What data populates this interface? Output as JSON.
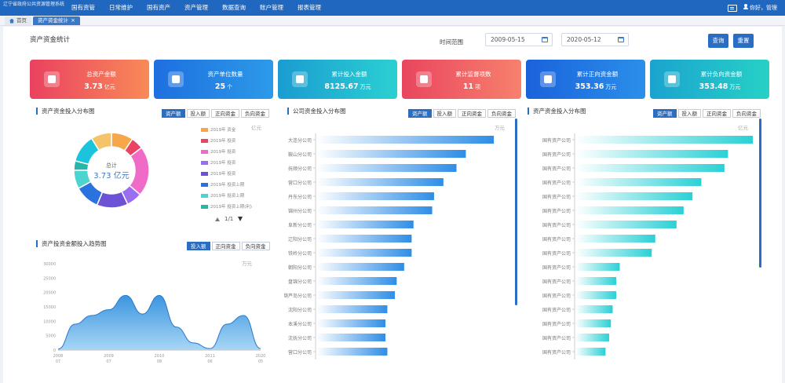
{
  "app": {
    "title": "辽宁省政府公共资源管理系统"
  },
  "nav": [
    "国有资管",
    "日常维护",
    "国有资产",
    "资产管理",
    "数据查询",
    "账户管理",
    "报表管理"
  ],
  "top_right": {
    "user": "你好，管理"
  },
  "tabs": [
    {
      "label": "首页"
    },
    {
      "label": "资产资金统计"
    }
  ],
  "filters": {
    "page_title": "资产资金统计",
    "time_label": "时间范围",
    "date_from": "2009-05-15",
    "date_to": "2020-05-12",
    "query_label": "查询",
    "reset_label": "重置"
  },
  "colors": {
    "accent": "#2a6ec4"
  },
  "cards": [
    {
      "title": "总资产金额",
      "value": "3.73",
      "unit": "亿元",
      "icon": "money-icon",
      "gradient": [
        "#ea4161",
        "#f98a57"
      ]
    },
    {
      "title": "资产单位数量",
      "value": "25",
      "unit": "个",
      "icon": "building-icon",
      "gradient": [
        "#1e6fe0",
        "#2c9ae8"
      ]
    },
    {
      "title": "累计投入金额",
      "value": "8125.67",
      "unit": "万元",
      "icon": "money-bag-icon",
      "gradient": [
        "#1a9cd1",
        "#2bd0d2"
      ]
    },
    {
      "title": "累计监督项数",
      "value": "11",
      "unit": "项",
      "icon": "puzzle-icon",
      "gradient": [
        "#e9455e",
        "#f7816d"
      ]
    },
    {
      "title": "累计正向资金额",
      "value": "353.36",
      "unit": "万元",
      "icon": "arrow-up-icon",
      "gradient": [
        "#1a62dc",
        "#2b8fea"
      ]
    },
    {
      "title": "累计负向资金额",
      "value": "353.48",
      "unit": "万元",
      "icon": "arrow-down-icon",
      "gradient": [
        "#1aa3cf",
        "#27d1c6"
      ]
    }
  ],
  "panel_donut": {
    "title": "资产资金投入分布图",
    "tabs": [
      "资产额",
      "投入额",
      "正向资金",
      "负向资金"
    ],
    "unit": "亿元",
    "center_label": "总计",
    "center_value": "3.73 亿元",
    "page_text": "1/1"
  },
  "panel_company": {
    "title": "公司资金投入分布图",
    "tabs": [
      "资产额",
      "投入额",
      "正向资金",
      "负向资金"
    ],
    "unit": "万元"
  },
  "panel_right": {
    "title": "资产资金投入分布图",
    "tabs": [
      "资产额",
      "投入额",
      "正向资金",
      "负向资金"
    ],
    "unit": "亿元"
  },
  "panel_trend": {
    "title": "资产投资金额投入趋势图",
    "tabs": [
      "投入额",
      "正向资金",
      "负向资金"
    ],
    "unit": "万元"
  },
  "chart_data": [
    {
      "type": "pie",
      "title": "资产资金投入分布图",
      "categories": [
        "2019年 资金",
        "2019年 投资",
        "2019年 投资",
        "2019年 投资",
        "2019年 投资",
        "2019年 投资上期",
        "2019年 投资上期",
        "2019年 投资上期(利)",
        "2019年 投资",
        "2019年 投资"
      ],
      "values": [
        0.35,
        0.2,
        0.8,
        0.25,
        0.5,
        0.4,
        0.3,
        0.15,
        0.45,
        0.33
      ],
      "colors": [
        "#f6a64b",
        "#ea4463",
        "#f06bc8",
        "#9a6ef0",
        "#6d52d6",
        "#2a72e0",
        "#4dd4d0",
        "#29b6a8",
        "#1cc3dc",
        "#f4c36a"
      ]
    },
    {
      "type": "bar",
      "orientation": "horizontal",
      "title": "公司资金投入分布图",
      "categories": [
        "大连分公司",
        "鞍山分公司",
        "抚顺分公司",
        "营口分公司",
        "丹东分公司",
        "锦州分公司",
        "阜新分公司",
        "辽阳分公司",
        "铁岭分公司",
        "朝阳分公司",
        "盘锦分公司",
        "葫芦岛分公司",
        "沈阳分公司",
        "本溪分公司",
        "沈抚分公司",
        "营口分公司"
      ],
      "values": [
        95,
        80,
        75,
        68,
        63,
        62,
        52,
        51,
        51,
        47,
        43,
        42,
        38,
        37,
        37,
        38
      ],
      "xlim": [
        0,
        100
      ]
    },
    {
      "type": "bar",
      "orientation": "horizontal",
      "title": "资产资金投入分布图",
      "categories": [
        "国有资产公司",
        "国有资产公司",
        "国有资产公司",
        "国有资产公司",
        "国有资产公司",
        "国有资产公司",
        "国有资产公司",
        "国有资产公司",
        "国有资产公司",
        "国有资产公司",
        "国有资产公司",
        "国有资产公司",
        "国有资产公司",
        "国有资产公司",
        "国有资产公司",
        "国有资产公司"
      ],
      "values": [
        100,
        86,
        84,
        71,
        66,
        61,
        57,
        45,
        43,
        25,
        23,
        23,
        21,
        20,
        19,
        17
      ],
      "xlim": [
        0,
        100
      ]
    },
    {
      "type": "area",
      "title": "资产投资金额投入趋势图",
      "x": [
        "2008-07",
        "2009-07",
        "2010-08",
        "2011-06",
        "2012-08",
        "2013-05",
        "2014-05",
        "2015-05",
        "2016-05",
        "2017-05",
        "2018-05",
        "2019-05",
        "2020-05"
      ],
      "values": [
        300,
        9000,
        12000,
        14000,
        19000,
        12500,
        19000,
        8000,
        2500,
        500,
        9000,
        12000,
        500
      ],
      "ylim": [
        0,
        30000
      ],
      "yticks": [
        0,
        5000,
        10000,
        15000,
        20000,
        25000,
        30000
      ],
      "xticks": [
        "2008\n07",
        "2009\n07",
        "2010\n08",
        "2011\n06",
        "2020\n05"
      ]
    }
  ]
}
